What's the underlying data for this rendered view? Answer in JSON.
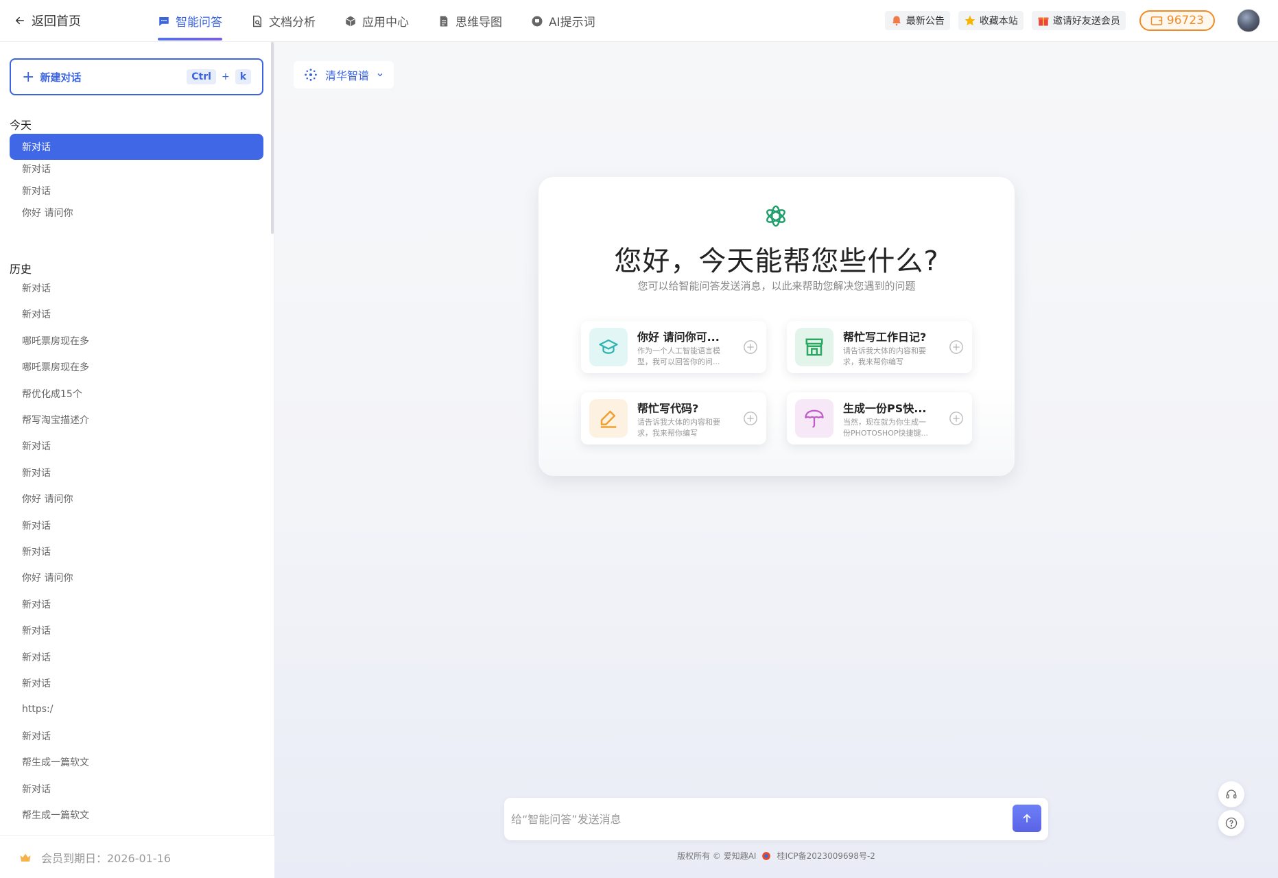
{
  "topbar": {
    "back_label": "返回首页",
    "tabs": [
      {
        "label": "智能问答",
        "icon": "chat-icon",
        "active": true
      },
      {
        "label": "文档分析",
        "icon": "document-search-icon",
        "active": false
      },
      {
        "label": "应用中心",
        "icon": "cube-icon",
        "active": false
      },
      {
        "label": "思维导图",
        "icon": "file-icon",
        "active": false
      },
      {
        "label": "AI提示词",
        "icon": "prompt-icon",
        "active": false
      }
    ],
    "chips": [
      {
        "label": "最新公告",
        "icon": "announcement-icon"
      },
      {
        "label": "收藏本站",
        "icon": "star-icon"
      },
      {
        "label": "邀请好友送会员",
        "icon": "gift-icon"
      }
    ],
    "coins": "96723"
  },
  "sidebar": {
    "new_chat_label": "新建对话",
    "shortcut": {
      "key1": "Ctrl",
      "plus": "+",
      "key2": "k"
    },
    "today_title": "今天",
    "today_items": [
      "新对话",
      "新对话",
      "新对话",
      "你好 请问你"
    ],
    "history_title": "历史",
    "history_items": [
      "新对话",
      "新对话",
      "哪吒票房现在多",
      "哪吒票房现在多",
      "帮优化成15个",
      "帮写淘宝描述介",
      "新对话",
      "新对话",
      "你好 请问你",
      "新对话",
      "新对话",
      "你好 请问你",
      "新对话",
      "新对话",
      "新对话",
      "新对话",
      "https:/",
      "新对话",
      "帮生成一篇软文",
      "新对话",
      "帮生成一篇软文"
    ],
    "footer": "会员到期日：2026-01-16"
  },
  "main": {
    "model": "清华智谱",
    "greeting": "您好，今天能帮您些什么?",
    "subtitle": "您可以给智能问答发送消息，以此来帮助您解决您遇到的问题",
    "suggestions": [
      {
        "title": "你好 请问你可...",
        "desc": "作为一个人工智能语言模型，我可以回答你的问...",
        "icon": "graduation-cap-icon",
        "bg": "#e3f6f6",
        "color": "#2fb3b0"
      },
      {
        "title": "帮忙写工作日记?",
        "desc": "请告诉我大体的内容和要求，我来帮你编写",
        "icon": "storefront-icon",
        "bg": "#e3f5ea",
        "color": "#2aa860"
      },
      {
        "title": "帮忙写代码?",
        "desc": "请告诉我大体的内容和要求，我来帮你编写",
        "icon": "pencil-icon",
        "bg": "#fdf1e1",
        "color": "#f0a030"
      },
      {
        "title": "生成一份PS快...",
        "desc": "当然，现在就为你生成一份PHOTOSHOP快捷键...",
        "icon": "umbrella-icon",
        "bg": "#f6e8f7",
        "color": "#c25ac9"
      }
    ],
    "input_placeholder": "给“智能问答”发送消息",
    "footer_copyright": "版权所有 © 爱知趣AI",
    "footer_icp": "桂ICP备2023009698号-2"
  }
}
